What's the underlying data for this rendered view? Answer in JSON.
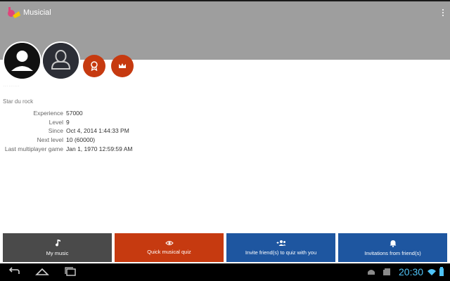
{
  "app": {
    "title": "Musicial"
  },
  "profile": {
    "ghost_name": "·········",
    "subtitle": "Star du rock",
    "stats": [
      {
        "label": "Experience",
        "value": "57000"
      },
      {
        "label": "Level",
        "value": "9"
      },
      {
        "label": "Since",
        "value": "Oct 4, 2014 1:44:33 PM"
      },
      {
        "label": "Next level",
        "value": "10 (60000)"
      },
      {
        "label": "Last multiplayer game",
        "value": "Jan 1, 1970 12:59:59 AM"
      }
    ]
  },
  "actions": {
    "my_music": "My music",
    "quiz": "Quick musical quiz",
    "invite": "Invite friend(s) to quiz with you",
    "invitations": "Invitations from friend(s)"
  },
  "status_bar": {
    "time": "20:30"
  },
  "colors": {
    "header": "#9e9e9e",
    "accent": "#c63a10",
    "blue": "#1e56a0",
    "dark": "#4a4a4a"
  }
}
